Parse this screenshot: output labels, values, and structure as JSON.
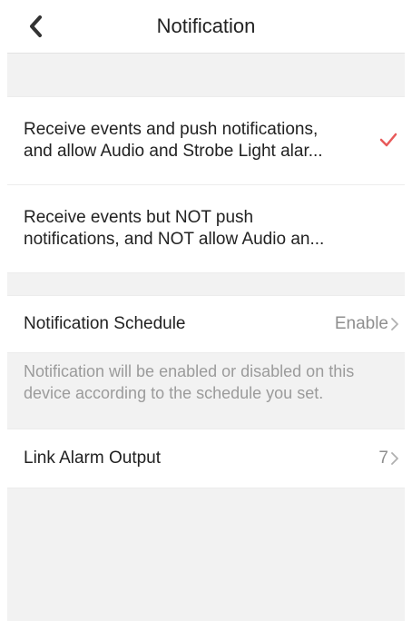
{
  "header": {
    "title": "Notification",
    "back_icon": "back-chevron-icon"
  },
  "options": [
    {
      "label": "Receive events and push notifications,\nand allow Audio and Strobe Light alar...",
      "selected": true,
      "check_icon": "check-icon"
    },
    {
      "label": "Receive events but NOT push\nnotifications, and NOT allow Audio an...",
      "selected": false
    }
  ],
  "schedule": {
    "label": "Notification Schedule",
    "value": "Enable",
    "hint": "Notification will be enabled or disabled on this\ndevice according to the schedule you set."
  },
  "alarm_output": {
    "label": "Link Alarm Output",
    "value": "7"
  },
  "colors": {
    "accent_check": "#e85a5a",
    "background": "#f2f2f2",
    "card": "#ffffff",
    "muted_text": "#9b9b9b"
  }
}
